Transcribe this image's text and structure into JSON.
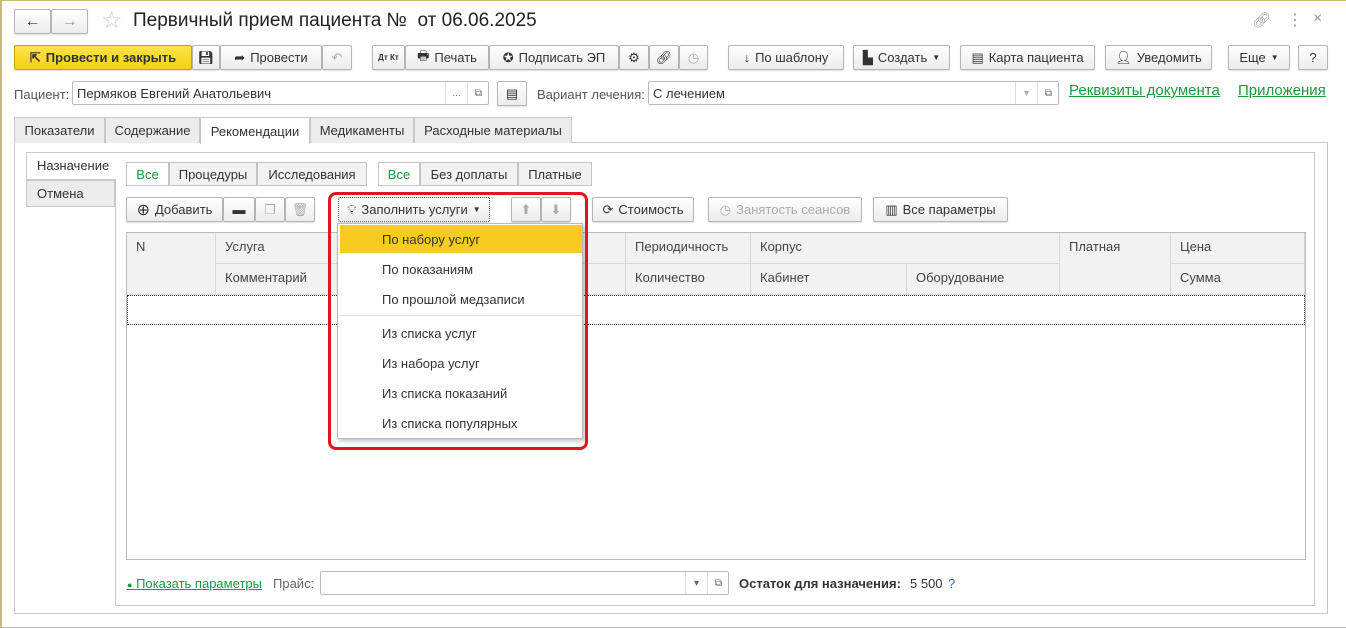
{
  "title": "Первичный прием пациента №  от 06.06.2025",
  "toolbar": {
    "post_close": "Провести и закрыть",
    "post": "Провести",
    "print": "Печать",
    "sign": "Подписать ЭП",
    "dtkt": "Дт Кт",
    "by_template": "По шаблону",
    "create": "Создать",
    "patient_card": "Карта пациента",
    "notify": "Уведомить",
    "more": "Еще",
    "help": "?"
  },
  "fields": {
    "patient_label": "Пациент:",
    "patient_value": "Пермяков Евгений Анатольевич",
    "choose": "...",
    "variant_label": "Вариант лечения:",
    "variant_value": "С лечением"
  },
  "links": {
    "requisites": "Реквизиты документа",
    "attachments": "Приложения"
  },
  "tabs": [
    "Показатели",
    "Содержание",
    "Рекомендации",
    "Медикаменты",
    "Расходные материалы"
  ],
  "side_tabs": [
    "Назначение",
    "Отмена"
  ],
  "filter1": [
    "Все",
    "Процедуры",
    "Исследования"
  ],
  "filter2": [
    "Все",
    "Без доплаты",
    "Платные"
  ],
  "actions": {
    "add": "Добавить",
    "fill": "Заполнить услуги",
    "cost": "Стоимость",
    "sessions": "Занятость сеансов",
    "all_params": "Все параметры"
  },
  "table": {
    "headers": {
      "n": "N",
      "service": "Услуга",
      "comment": "Комментарий",
      "period": "Периодичность",
      "quantity": "Количество",
      "building": "Корпус",
      "room": "Кабинет",
      "equipment": "Оборудование",
      "paid": "Платная",
      "price": "Цена",
      "sum": "Сумма"
    }
  },
  "menu": {
    "group1": [
      "По набору услуг",
      "По показаниям",
      "По прошлой медзаписи"
    ],
    "group2": [
      "Из списка услуг",
      "Из набора услуг",
      "Из списка показаний",
      "Из списка популярных"
    ]
  },
  "footer": {
    "show_params": "Показать параметры",
    "price_label": "Прайс:",
    "price_value": "",
    "remainder_label": "Остаток для назначения:",
    "remainder_value": "5 500",
    "help": "?"
  }
}
